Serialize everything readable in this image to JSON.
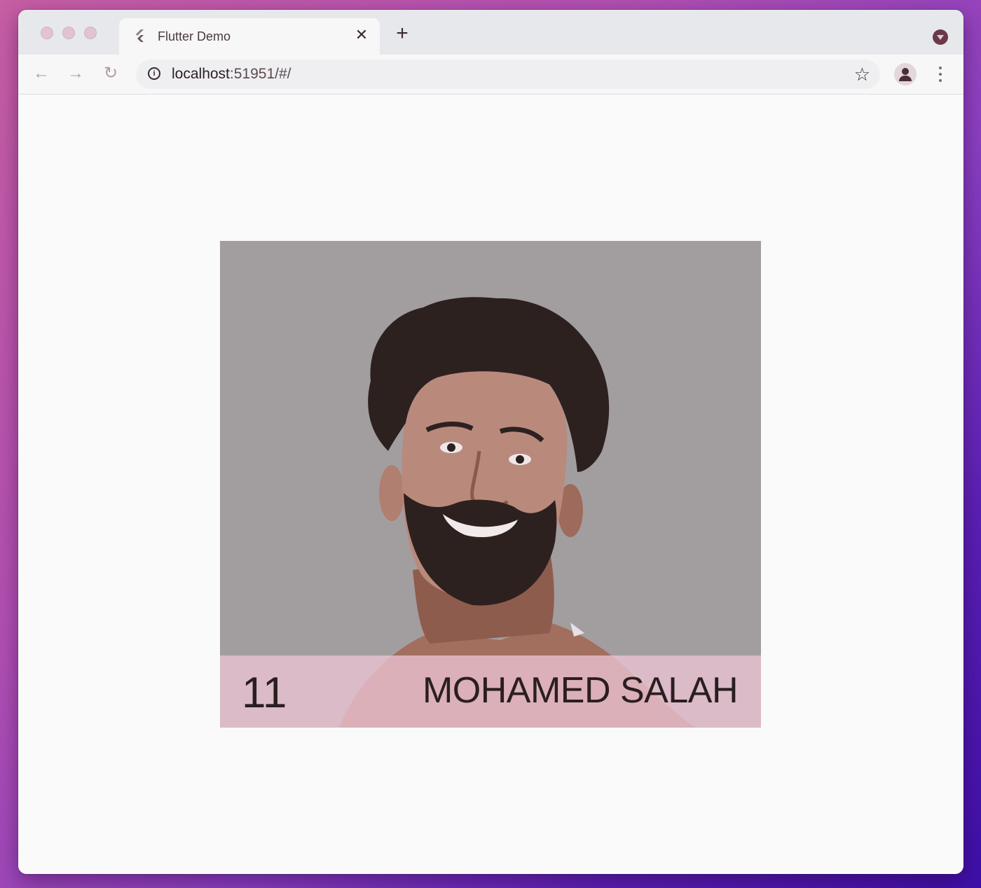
{
  "browser": {
    "tab": {
      "title": "Flutter Demo",
      "close_glyph": "✕"
    },
    "new_tab_glyph": "+",
    "nav": {
      "back_glyph": "←",
      "forward_glyph": "→",
      "reload_glyph": "↻"
    },
    "address_bar": {
      "host": "localhost",
      "rest": ":51951/#/",
      "info_glyph": "i"
    },
    "bookmark_glyph": "☆"
  },
  "player_card": {
    "number": "11",
    "name": "MOHAMED SALAH",
    "portrait_icon": "player-portrait"
  },
  "colors": {
    "card_background": "#a29e9f",
    "caption_overlay": "#ebc3d2",
    "text": "#2a1e20"
  }
}
